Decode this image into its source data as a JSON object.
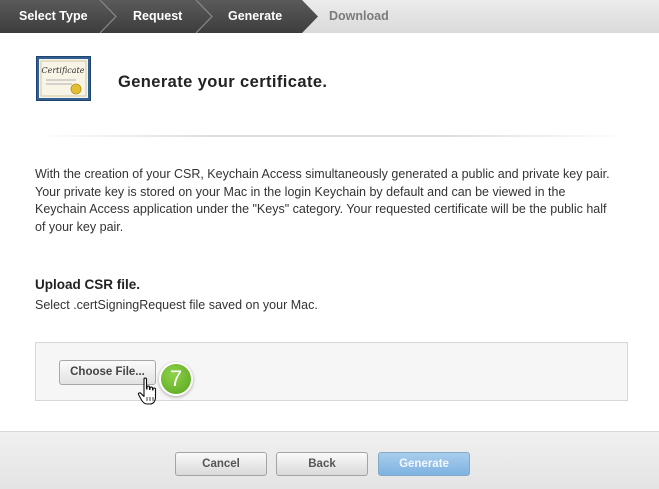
{
  "steps": [
    {
      "label": "Select Type",
      "state": "done"
    },
    {
      "label": "Request",
      "state": "done"
    },
    {
      "label": "Generate",
      "state": "current"
    },
    {
      "label": "Download",
      "state": "upcoming"
    }
  ],
  "header": {
    "icon": "certificate-icon",
    "icon_text": "Certificate",
    "title": "Generate your certificate."
  },
  "description": "With the creation of your CSR, Keychain Access simultaneously generated a public and private key pair. Your private key is stored on your Mac in the login Keychain by default and can be viewed in the Keychain Access application under the \"Keys\" category. Your requested certificate will be the public half of your key pair.",
  "upload": {
    "heading": "Upload CSR file.",
    "hint": "Select .certSigningRequest file saved on your Mac.",
    "choose_button": "Choose File...",
    "annotation_number": "7"
  },
  "footer": {
    "cancel": "Cancel",
    "back": "Back",
    "generate": "Generate"
  },
  "colors": {
    "step_done": "#4a4a4a",
    "step_current": "#3a3a3a",
    "step_upcoming": "#e3e3e3",
    "generate_button": "#8ec0e7",
    "annotation_badge": "#6bb52b"
  }
}
